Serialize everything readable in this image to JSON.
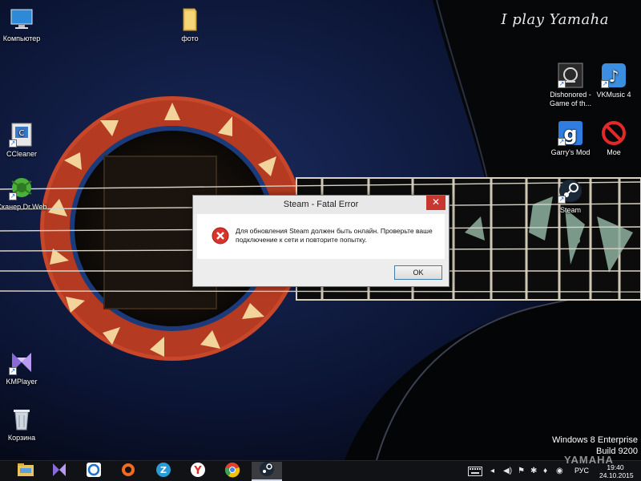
{
  "wallpaper": {
    "brand": "I play Yamaha",
    "os_edition": "Windows 8 Enterprise",
    "os_build": "Build 9200",
    "footer_mark": "YAMAHA"
  },
  "desktop_icons": {
    "computer": "Компьютер",
    "photo": "фото",
    "ccleaner": "CCleaner",
    "drweb": "Сканер Dr.Web",
    "kmplayer": "KMPlayer",
    "recycle": "Корзина",
    "dishonored": "Dishonored - Game of th...",
    "vkmusic": "VKMusic 4",
    "garrysmod": "Garry's Mod",
    "moe": "Мое",
    "steam": "Steam"
  },
  "dialog": {
    "title": "Steam - Fatal Error",
    "close": "✕",
    "message": "Для обновления Steam должен быть онлайн. Проверьте ваше подключение к сети и повторите попытку.",
    "ok": "OK"
  },
  "taskbar": {
    "language": "РУС",
    "time": "19:40",
    "date": "24.10.2015"
  },
  "colors": {
    "error_red": "#d9342b",
    "steam_blue": "#1b2838",
    "dialog_close": "#c7372f"
  }
}
